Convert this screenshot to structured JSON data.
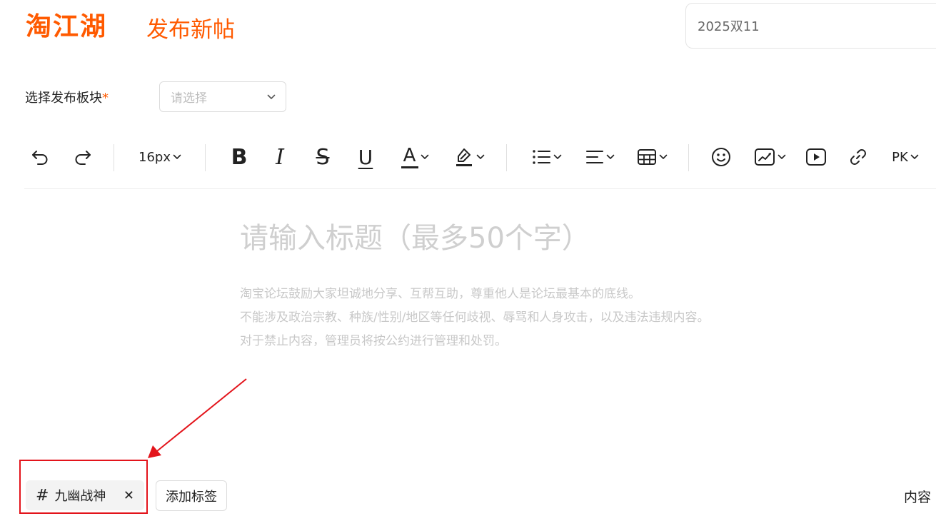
{
  "header": {
    "logo_text": "淘江湖",
    "page_title": "发布新帖",
    "search_value": "2025双11"
  },
  "board": {
    "label": "选择发布板块",
    "required_mark": "*",
    "placeholder": "请选择"
  },
  "toolbar": {
    "font_size": "16px",
    "bold_glyph": "B",
    "italic_glyph": "I",
    "strike_glyph": "S",
    "underline_glyph": "U",
    "font_color_glyph": "A",
    "pk_label": "PK",
    "icons": [
      "undo-icon",
      "redo-icon",
      "font-size-dropdown",
      "bold-icon",
      "italic-icon",
      "strikethrough-icon",
      "underline-icon",
      "font-color-icon",
      "highlight-icon",
      "list-icon",
      "align-icon",
      "table-icon",
      "emoji-icon",
      "image-icon",
      "video-icon",
      "link-icon",
      "pk-dropdown"
    ]
  },
  "editor": {
    "title_placeholder": "请输入标题（最多50个字）",
    "guidelines": [
      "淘宝论坛鼓励大家坦诚地分享、互帮互助，尊重他人是论坛最基本的底线。",
      "不能涉及政治宗教、种族/性别/地区等任何歧视、辱骂和人身攻击，以及违法违规内容。",
      "对于禁止内容，管理员将按公约进行管理和处罚。"
    ]
  },
  "tags": {
    "items": [
      {
        "hash": "#",
        "label": "九幽战神",
        "close": "✕"
      }
    ],
    "add_label": "添加标签"
  },
  "footer": {
    "content_label": "内容"
  },
  "colors": {
    "brand": "#ff5a00",
    "annotation": "#e3141b",
    "placeholder": "#cfcfcf"
  }
}
